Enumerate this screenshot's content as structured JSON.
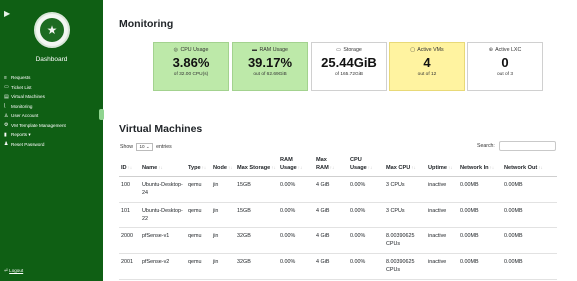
{
  "sidebar": {
    "collapse_icon": "chevron-right-icon",
    "logo_icon": "star-seal-icon",
    "title": "Dashboard",
    "items": [
      {
        "label": "Requests",
        "icon": "list-icon",
        "glyph": "≡"
      },
      {
        "label": "Ticket List",
        "icon": "ticket-icon",
        "glyph": "▭"
      },
      {
        "label": "Virtual Machines",
        "icon": "server-icon",
        "glyph": "▤"
      },
      {
        "label": "Monitoring",
        "icon": "chart-icon",
        "glyph": "⌊"
      },
      {
        "label": "User Account",
        "icon": "user-icon",
        "glyph": "♙"
      },
      {
        "label": "VM Template Management",
        "icon": "gear-icon",
        "glyph": "⚙"
      },
      {
        "label": "Reports ▾",
        "icon": "file-icon",
        "glyph": "▮"
      },
      {
        "label": "Reset Password",
        "icon": "users-icon",
        "glyph": "♟"
      }
    ],
    "logout_label": "Logout",
    "logout_glyph": "⏎"
  },
  "monitoring": {
    "title": "Monitoring",
    "cards": [
      {
        "label": "CPU Usage",
        "icon": "cpu-icon",
        "glyph": "◎",
        "value": "3.86%",
        "sub": "of 32.00 CPU(s)",
        "level": 0.0386
      },
      {
        "label": "RAM Usage",
        "icon": "memory-icon",
        "glyph": "▬",
        "value": "39.17%",
        "sub": "out of 62.69GiB",
        "level": 0.3917
      },
      {
        "label": "Storage",
        "icon": "hdd-icon",
        "glyph": "▭",
        "value": "25.44GiB",
        "sub": "of 165.72GiB"
      },
      {
        "label": "Active VMs",
        "icon": "desktop-icon",
        "glyph": "▢",
        "value": "4",
        "sub": "out of 12"
      },
      {
        "label": "Active LXC",
        "icon": "container-icon",
        "glyph": "⊛",
        "value": "0",
        "sub": "out of 3"
      }
    ],
    "colors": {
      "green": "#bde9a9",
      "yellow": "#fff3a0",
      "sidebar": "#0f5f14"
    }
  },
  "vm": {
    "title": "Virtual Machines",
    "show_prefix": "Show",
    "entries_value": "10",
    "show_suffix": "entries",
    "search_label": "Search:",
    "search_value": "",
    "sort_glyph": "↑↓",
    "columns": [
      "ID",
      "Name",
      "Type",
      "Node",
      "Max Storage",
      "RAM Usage",
      "Max RAM",
      "CPU Usage",
      "Max CPU",
      "Uptime",
      "Network In",
      "Network Out"
    ],
    "rows": [
      [
        "100",
        "Ubuntu-Desktop-24",
        "qemu",
        "jin",
        "15GB",
        "0.00%",
        "4 GiB",
        "0.00%",
        "3 CPUs",
        "inactive",
        "0.00MB",
        "0.00MB"
      ],
      [
        "101",
        "Ubuntu-Desktop-22",
        "qemu",
        "jin",
        "15GB",
        "0.00%",
        "4 GiB",
        "0.00%",
        "3 CPUs",
        "inactive",
        "0.00MB",
        "0.00MB"
      ],
      [
        "2000",
        "pfSense-v1",
        "qemu",
        "jin",
        "32GB",
        "0.00%",
        "4 GiB",
        "0.00%",
        "8.00390625 CPUs",
        "inactive",
        "0.00MB",
        "0.00MB"
      ],
      [
        "2001",
        "pfSense-v2",
        "qemu",
        "jin",
        "32GB",
        "0.00%",
        "4 GiB",
        "0.00%",
        "8.00390625 CPUs",
        "inactive",
        "0.00MB",
        "0.00MB"
      ]
    ]
  }
}
